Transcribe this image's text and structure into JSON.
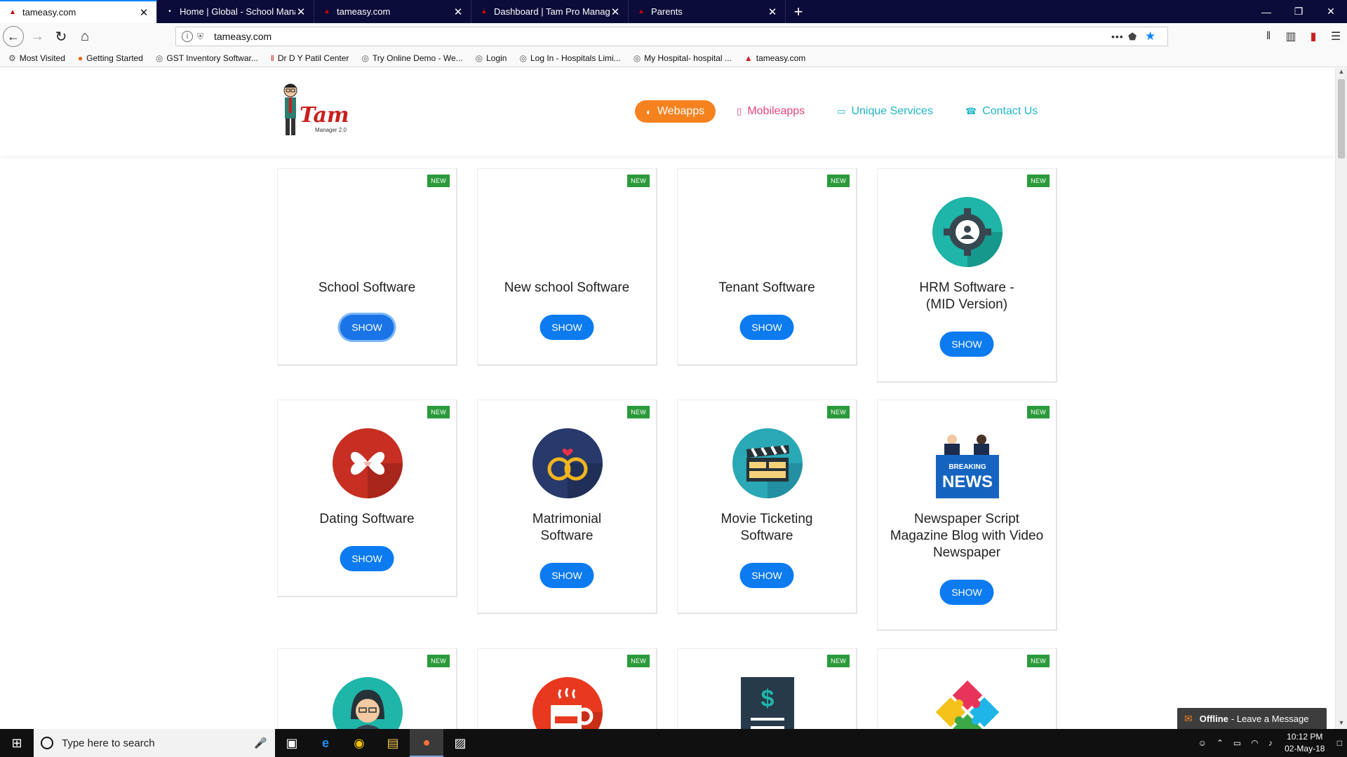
{
  "browser": {
    "tabs": [
      {
        "label": "tameasy.com",
        "active": true
      },
      {
        "label": "Home | Global - School Manag",
        "active": false
      },
      {
        "label": "tameasy.com",
        "active": false
      },
      {
        "label": "Dashboard | Tam Pro Managem",
        "active": false
      },
      {
        "label": "Parents",
        "active": false
      }
    ],
    "url": "tameasy.com",
    "bookmarks": [
      "Most Visited",
      "Getting Started",
      "GST Inventory Softwar...",
      "Dr D Y Patil Center",
      "Try Online Demo - We...",
      "Login",
      "Log In - Hospitals Limi...",
      "My Hospital- hospital ...",
      "tameasy.com"
    ]
  },
  "site": {
    "logo": {
      "brand": "Tam",
      "sub": "Manager 2.0"
    },
    "nav": {
      "webapps": "Webapps",
      "mobileapps": "Mobileapps",
      "services": "Unique Services",
      "contact": "Contact Us"
    },
    "badge_label": "NEW",
    "button_label": "SHOW",
    "cards": [
      {
        "title": "School Software",
        "icon": "none"
      },
      {
        "title": "New school Software",
        "icon": "none"
      },
      {
        "title": "Tenant Software",
        "icon": "none"
      },
      {
        "title": "HRM Software - (MID Version)",
        "icon": "gear-person-icon"
      },
      {
        "title": "Dating Software",
        "icon": "hearts-icon"
      },
      {
        "title": "Matrimonial Software",
        "icon": "rings-icon"
      },
      {
        "title": "Movie Ticketing Software",
        "icon": "clapperboard-icon"
      },
      {
        "title": "Newspaper Script Magazine Blog with Video Newspaper",
        "icon": "breaking-news-icon"
      },
      {
        "title": "",
        "icon": "woman-avatar-icon"
      },
      {
        "title": "",
        "icon": "coffee-cup-icon"
      },
      {
        "title": "",
        "icon": "dollar-document-icon"
      },
      {
        "title": "",
        "icon": "puzzle-icon"
      }
    ],
    "chat": {
      "status": "Offline",
      "message": "- Leave a Message"
    }
  },
  "taskbar": {
    "search_placeholder": "Type here to search",
    "time": "10:12 PM",
    "date": "02-May-18"
  }
}
